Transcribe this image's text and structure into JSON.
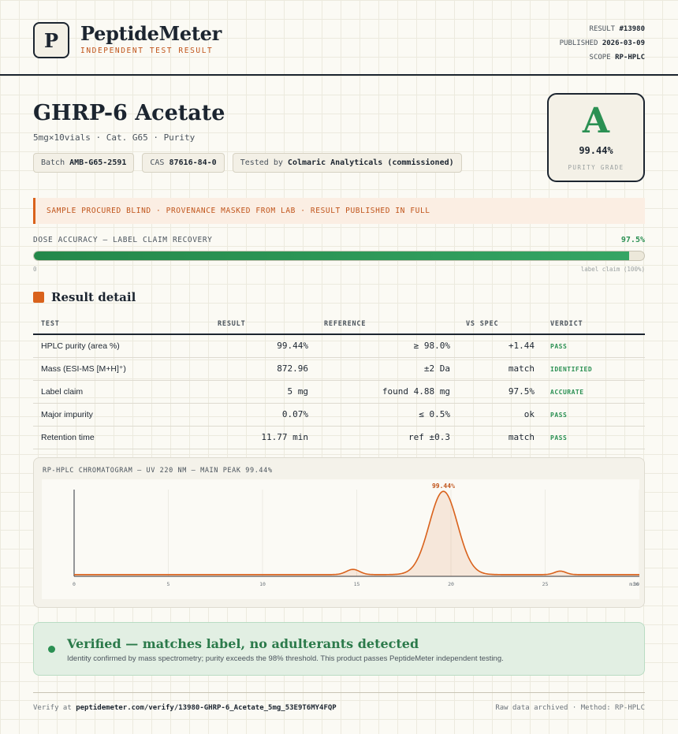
{
  "header": {
    "logo_letter": "P",
    "brand": "PeptideMeter",
    "brand_sub": "INDEPENDENT TEST RESULT",
    "result_label": "RESULT",
    "result_value": "#13980",
    "published_label": "PUBLISHED",
    "published_value": "2026-03-09",
    "scope_label": "SCOPE",
    "scope_value": "RP-HPLC"
  },
  "product": {
    "title": "GHRP-6 Acetate",
    "subtitle": "5mg×10vials · Cat. G65 · Purity",
    "batch_label": "Batch",
    "batch_value": "AMB-G65-2591",
    "cas_label": "CAS",
    "cas_value": "87616-84-0",
    "tested_label": "Tested by",
    "tested_value": "Colmaric Analyticals (commissioned)"
  },
  "grade": {
    "letter": "A",
    "value": "99.44%",
    "label": "PURITY GRADE",
    "color": "#2b9053"
  },
  "notice": "SAMPLE PROCURED BLIND · PROVENANCE MASKED FROM LAB · RESULT PUBLISHED IN FULL",
  "dose": {
    "label": "DOSE ACCURACY — LABEL CLAIM RECOVERY",
    "value_text": "97.5%",
    "fill_percent": 97.5,
    "min_label": "0",
    "max_label": "label claim (100%)"
  },
  "section_title": "Result detail",
  "table": {
    "headers": [
      "TEST",
      "RESULT",
      "REFERENCE",
      "VS SPEC",
      "VERDICT"
    ],
    "rows": [
      {
        "test": "HPLC purity (area %)",
        "result": "99.44%",
        "reference": "≥ 98.0%",
        "vs": "+1.44",
        "verdict": "PASS"
      },
      {
        "test": "Mass (ESI-MS [M+H]⁺)",
        "result": "872.96",
        "reference": "±2 Da",
        "vs": "match",
        "verdict": "IDENTIFIED"
      },
      {
        "test": "Label claim",
        "result": "5 mg",
        "reference": "found 4.88 mg",
        "vs": "97.5%",
        "verdict": "ACCURATE"
      },
      {
        "test": "Major impurity",
        "result": "0.07%",
        "reference": "≤ 0.5%",
        "vs": "ok",
        "verdict": "PASS"
      },
      {
        "test": "Retention time",
        "result": "11.77 min",
        "reference": "ref ±0.3",
        "vs": "match",
        "verdict": "PASS"
      }
    ]
  },
  "chart_data": {
    "type": "line",
    "title": "RP-HPLC CHROMATOGRAM — UV 220 NM — MAIN PEAK 99.44%",
    "xlabel": "",
    "ylabel": "",
    "x_ticks": [
      "0",
      "5",
      "10",
      "15",
      "20",
      "25",
      "30"
    ],
    "x_unit": "min",
    "xlim": [
      0,
      30
    ],
    "peak_label": "99.44%",
    "baseline": 0.02,
    "peaks": [
      {
        "center": 14.8,
        "height": 0.06,
        "width": 0.35
      },
      {
        "center": 19.6,
        "height": 0.96,
        "width": 0.75
      },
      {
        "center": 25.8,
        "height": 0.04,
        "width": 0.3
      }
    ],
    "line_color": "#d9621c"
  },
  "verified": {
    "title": "Verified — matches label, no adulterants detected",
    "text": "Identity confirmed by mass spectrometry; purity exceeds the 98% threshold. This product passes PeptideMeter independent testing."
  },
  "footer": {
    "verify_label": "Verify at",
    "verify_url": "peptidemeter.com/verify/13980-GHRP-6_Acetate_5mg_53E9T6MY4FQP",
    "right_text": "Raw data archived · Method: RP-HPLC"
  }
}
